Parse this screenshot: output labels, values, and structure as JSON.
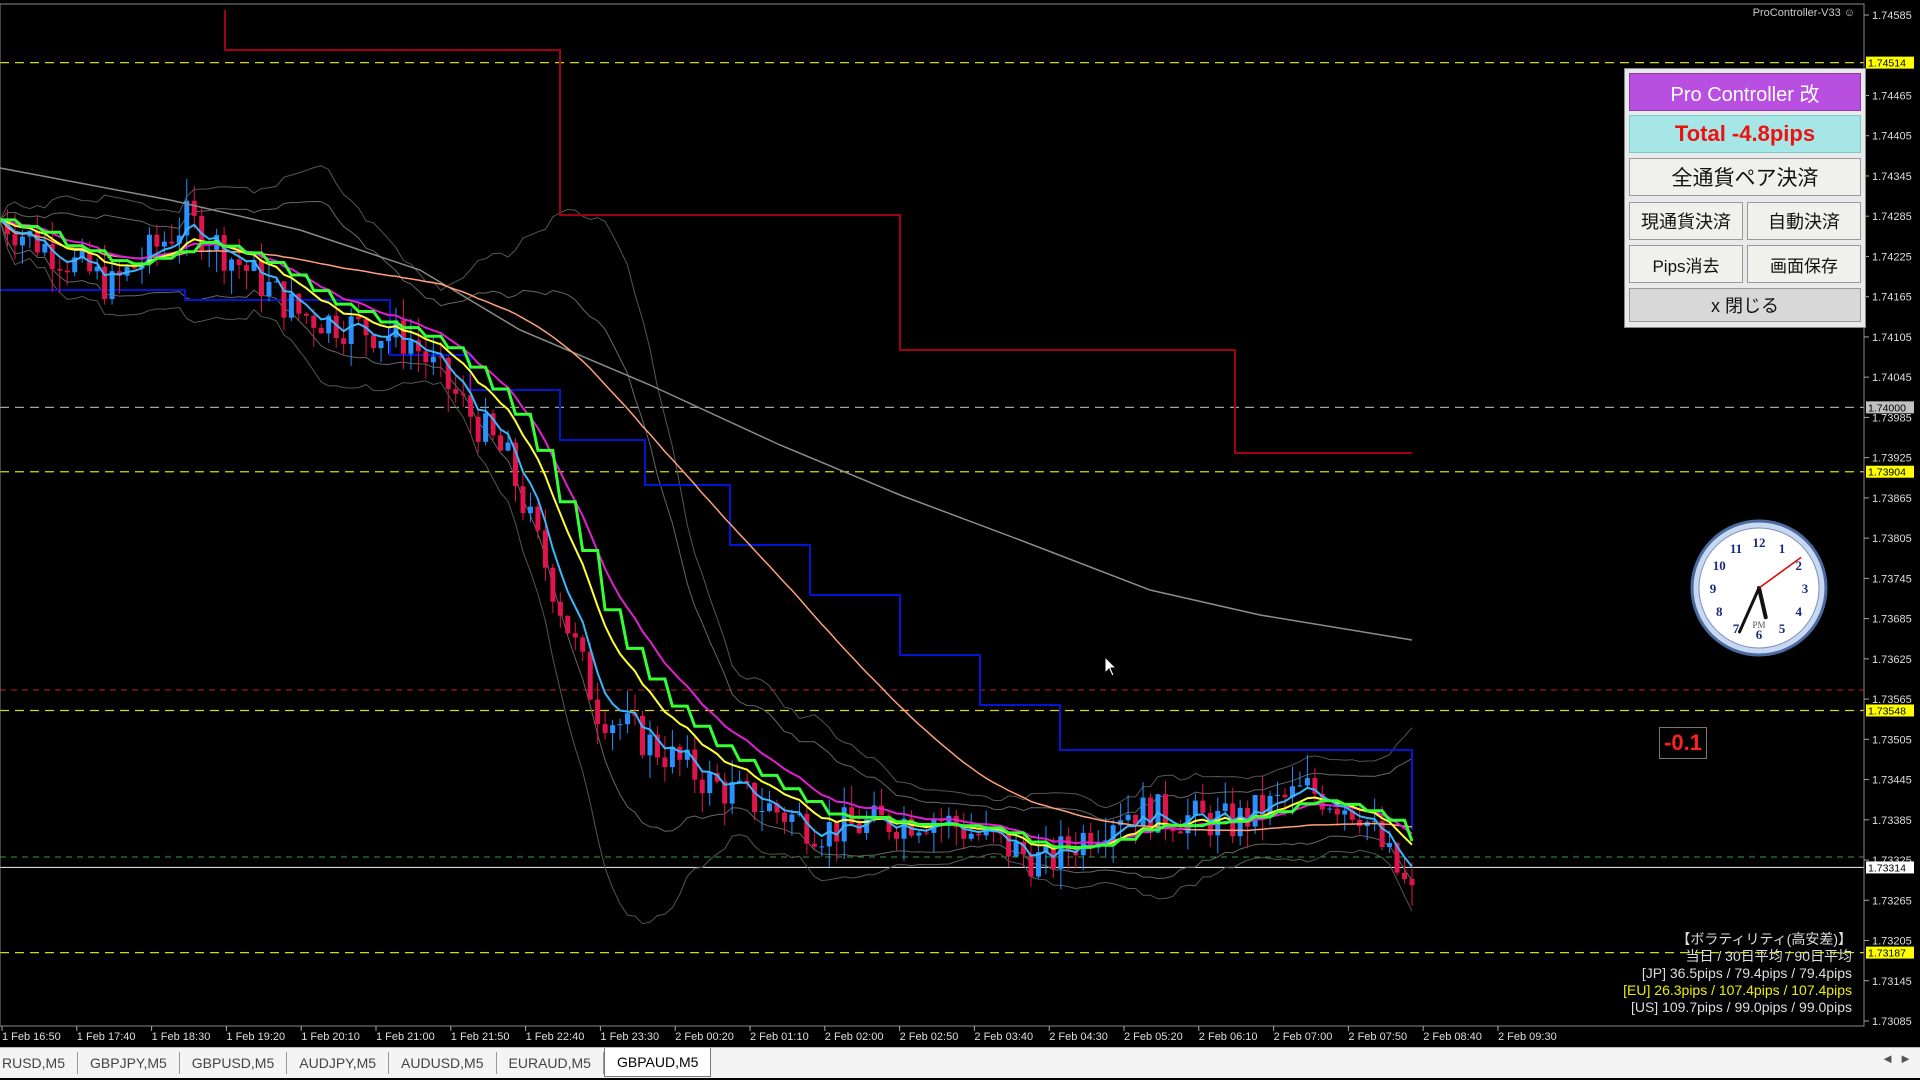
{
  "indicator_name": "ProController-V33",
  "colors": {
    "bull": "#2a8fff",
    "bear": "#e0144c",
    "ma_fast": "#3ab6ff",
    "ma_yellow": "#ffff33",
    "ma_magenta": "#e020d0",
    "ma_green": "#33ff33",
    "ma_salmon": "#ffa07a",
    "ma_gray": "#8c8c8c",
    "step_blue": "#0016d0",
    "step_red": "#a00014"
  },
  "panel": {
    "title": "Pro Controller 改",
    "total": "Total   -4.8pips",
    "close_all": "全通貨ペア決済",
    "close_current": "現通貨決済",
    "auto_close": "自動決済",
    "pips_clear": "Pips消去",
    "save_screen": "画面保存",
    "close": "x 閉じる"
  },
  "pl_label": "-0.1",
  "clock": {
    "period": "PM",
    "hour": 5,
    "minute": 34,
    "second": 9
  },
  "volatility": {
    "header": "【ボラティリティ(高安差)】",
    "sub": "当日 / 30日平均 / 90日平均",
    "jp": "[JP] 36.5pips / 79.4pips / 79.4pips",
    "eu": "[EU] 26.3pips / 107.4pips / 107.4pips",
    "us": "[US] 109.7pips / 99.0pips / 99.0pips"
  },
  "price_axis": {
    "ticks": [
      "1.74585",
      "1.74465",
      "1.74405",
      "1.74345",
      "1.74285",
      "1.74225",
      "1.74165",
      "1.74105",
      "1.74045",
      "1.73985",
      "1.73925",
      "1.73865",
      "1.73805",
      "1.73745",
      "1.73685",
      "1.73625",
      "1.73565",
      "1.73505",
      "1.73445",
      "1.73385",
      "1.73325",
      "1.73265",
      "1.73205",
      "1.73145",
      "1.73085"
    ],
    "levels": [
      {
        "price": "1.74514",
        "color": "#ffff00"
      },
      {
        "price": "1.74000",
        "color": "#c0c0c0"
      },
      {
        "price": "1.73904",
        "color": "#ffff00"
      },
      {
        "price": "1.73548",
        "color": "#ffff00"
      },
      {
        "price": "1.73314",
        "color": "#ffffff"
      },
      {
        "price": "1.73187",
        "color": "#ffff00"
      }
    ]
  },
  "time_axis": [
    "1 Feb 16:50",
    "1 Feb 17:40",
    "1 Feb 18:30",
    "1 Feb 19:20",
    "1 Feb 20:10",
    "1 Feb 21:00",
    "1 Feb 21:50",
    "1 Feb 22:40",
    "1 Feb 23:30",
    "2 Feb 00:20",
    "2 Feb 01:10",
    "2 Feb 02:00",
    "2 Feb 02:50",
    "2 Feb 03:40",
    "2 Feb 04:30",
    "2 Feb 05:20",
    "2 Feb 06:10",
    "2 Feb 07:00",
    "2 Feb 07:50",
    "2 Feb 08:40",
    "2 Feb 09:30"
  ],
  "tabs": [
    "RUSD,M5",
    "GBPJPY,M5",
    "GBPUSD,M5",
    "AUDJPY,M5",
    "AUDUSD,M5",
    "EURAUD,M5",
    "GBPAUD,M5"
  ],
  "active_tab": "GBPAUD,M5"
}
